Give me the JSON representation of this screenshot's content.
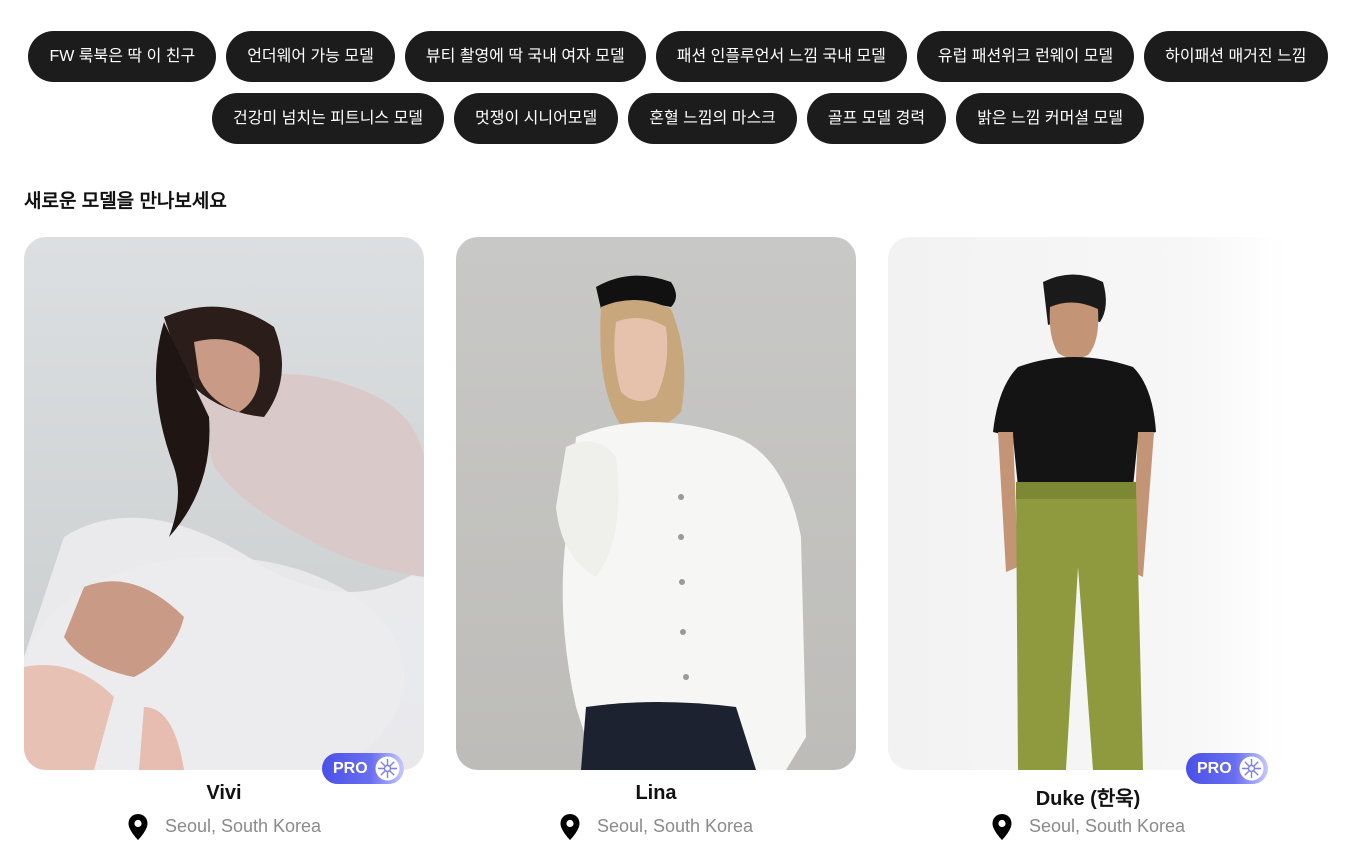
{
  "tags": {
    "row1": [
      "FW 룩북은 딱 이 친구",
      "언더웨어 가능 모델",
      "뷰티 촬영에 딱 국내 여자 모델",
      "패션 인플루언서 느낌 국내 모델",
      "유럽 패션위크 런웨이 모델",
      "하이패션 매거진 느낌"
    ],
    "row2": [
      "건강미 넘치는 피트니스 모델",
      "멋쟁이 시니어모델",
      "혼혈 느낌의 마스크",
      "골프 모델 경력",
      "밝은 느낌 커머셜 모델"
    ]
  },
  "section": {
    "title": "새로운 모델을 만나보세요"
  },
  "models": [
    {
      "name": "Vivi",
      "location": "Seoul, South Korea",
      "badge": "PRO"
    },
    {
      "name": "Lina",
      "location": "Seoul, South Korea",
      "badge": ""
    },
    {
      "name": "Duke (한욱)",
      "location": "Seoul, South Korea",
      "badge": "PRO"
    }
  ],
  "icons": {
    "location": "map-pin-icon",
    "pro_badge": "flower-badge-icon"
  },
  "colors": {
    "chip_bg": "#1c1c1c",
    "chip_text": "#ffffff",
    "pro_badge": "#4a50e6",
    "location_text": "#8a8a8a"
  }
}
